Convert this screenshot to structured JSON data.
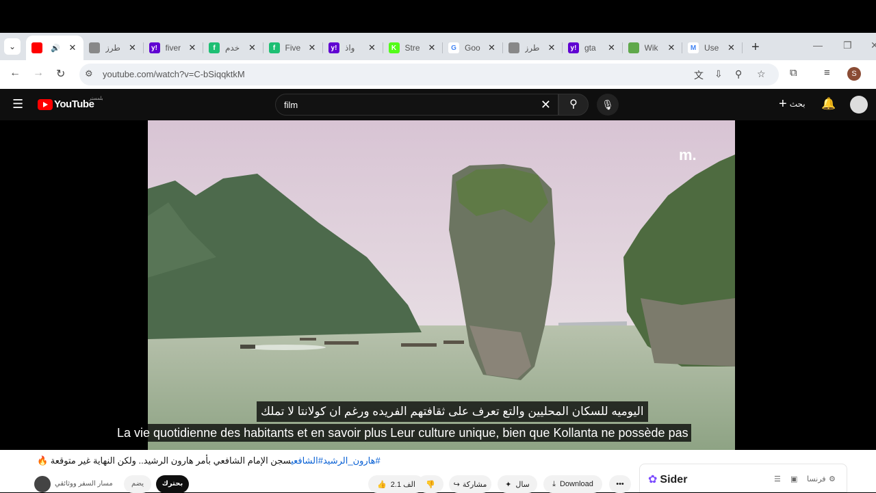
{
  "browser": {
    "tabs": [
      {
        "title": "",
        "favicon_color": "#ff0000",
        "favicon": "youtube-icon",
        "active": true,
        "audio": true
      },
      {
        "title": "طرز",
        "favicon_color": "#888888",
        "favicon": "gear-favicon"
      },
      {
        "title": "fiver",
        "favicon_color": "#6001d2",
        "favicon": "yahoo-favicon",
        "favicon_text": "y!"
      },
      {
        "title": "خدم",
        "favicon_color": "#1dbf73",
        "favicon": "fiverr-favicon",
        "favicon_text": "f"
      },
      {
        "title": "Five",
        "favicon_color": "#1dbf73",
        "favicon": "fiverr-favicon",
        "favicon_text": "f"
      },
      {
        "title": "واذ",
        "favicon_color": "#6001d2",
        "favicon": "yahoo-favicon",
        "favicon_text": "y!"
      },
      {
        "title": "Stre",
        "favicon_color": "#53fc18",
        "favicon": "kick-favicon",
        "favicon_text": "K"
      },
      {
        "title": "Goo",
        "favicon_color": "#ffffff",
        "favicon": "google-favicon",
        "favicon_text": "G"
      },
      {
        "title": "طرز",
        "favicon_color": "#888888",
        "favicon": "gear-favicon"
      },
      {
        "title": "gta",
        "favicon_color": "#6001d2",
        "favicon": "yahoo-favicon",
        "favicon_text": "y!"
      },
      {
        "title": "Wik",
        "favicon_color": "#5fa84a",
        "favicon": "leaf-favicon"
      },
      {
        "title": "Use",
        "favicon_color": "#ffffff",
        "favicon": "gmail-favicon",
        "favicon_text": "M"
      }
    ],
    "url": "youtube.com/watch?v=C-bSiqqktkM",
    "profile_initial": "S"
  },
  "youtube": {
    "logo_text": "YouTube",
    "logo_sup": "بلمستر",
    "search_value": "film",
    "create_label": "بحث"
  },
  "video": {
    "watermark": "m.",
    "subtitle_ar": "اليوميه للسكان المحليين والتع تعرف على ثقافتهم الفريده ورغم ان كولانتا لا تملك",
    "subtitle_fr": "La vie quotidienne des habitants et en savoir plus Leur culture unique, bien que Kollanta ne possède pas"
  },
  "below": {
    "title_tags": "#هارون_الرشيد#الشافعي",
    "title_text": "سجن الإمام الشافعي بأمر هارون الرشيد.. ولكن النهاية غير متوقعة 🔥",
    "channel_name": "مسار السفر ووثائقي",
    "subscribe_label": "يضم",
    "join_label": "بحترك",
    "like_count": "2.1 الف",
    "share_label": "مشاركة",
    "ask_label": "سال",
    "download_label": "Download",
    "sider_label": "Sider",
    "sider_lang": "فرنسا"
  }
}
